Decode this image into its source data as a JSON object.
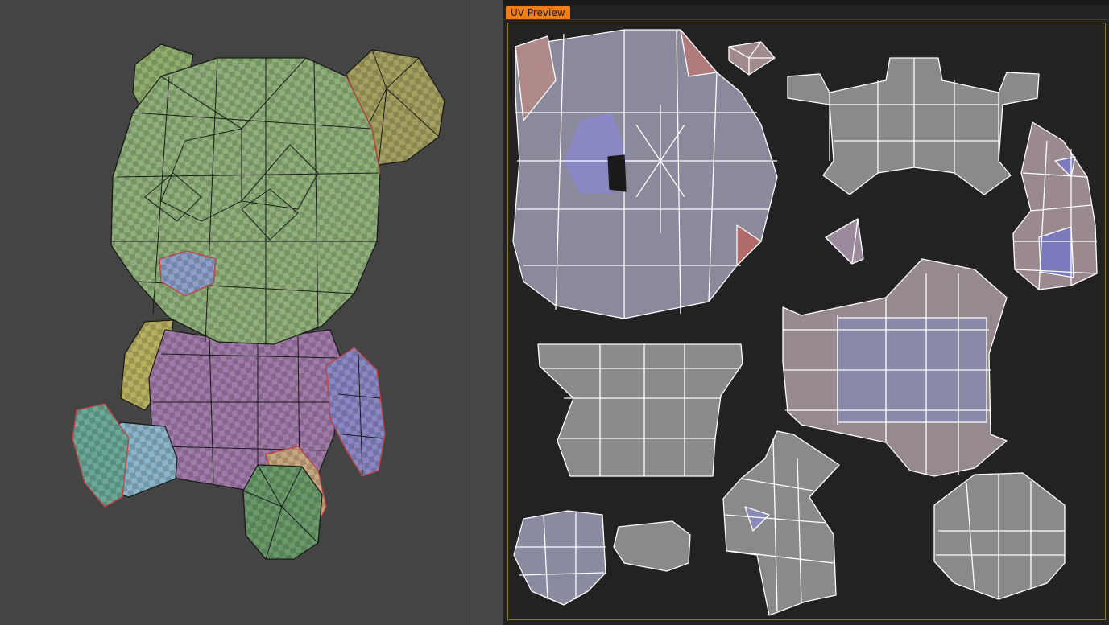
{
  "uv_panel": {
    "tab_label": "UV  Preview"
  },
  "viewport": {
    "model": "teddy-bear-mesh",
    "checker": true
  },
  "colors": {
    "tab_orange": "#f07e1a",
    "frame_gold": "#8a7a30",
    "head_green": "#8fb07a",
    "ear_olive": "#9a9860",
    "body_purple": "#a07aa8",
    "arm_blue": "#8a88c4",
    "leg_teal": "#6aa898",
    "foot_green": "#6a9a6a",
    "nose_blue": "#8ca0c8",
    "uv_grey": "#8a8a8a",
    "uv_blue": "#8a8ab8",
    "uv_red": "#b08080",
    "seam_red": "#c04040"
  }
}
